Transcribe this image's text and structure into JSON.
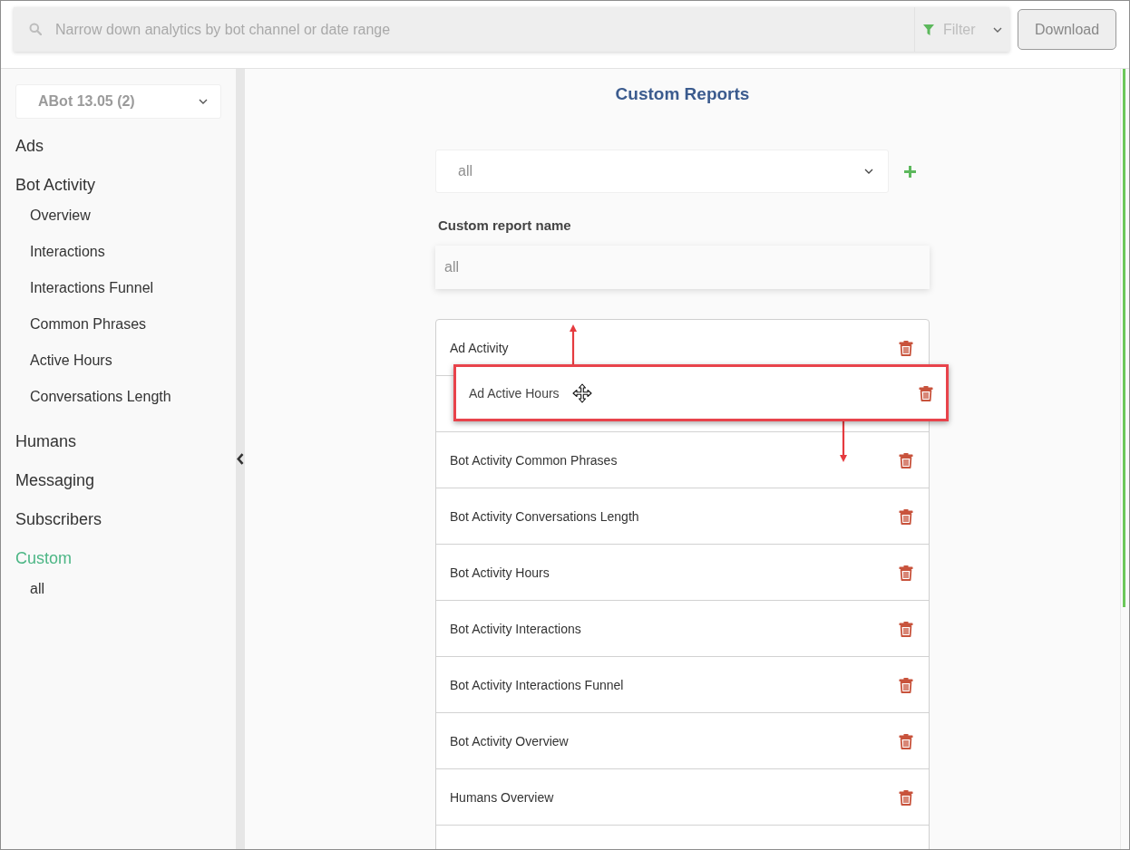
{
  "top_bar": {
    "search": {
      "placeholder": "Narrow down analytics by bot channel or date range"
    },
    "filter": {
      "label": "Filter"
    },
    "download_button": "Download"
  },
  "sidebar": {
    "bot_selector": {
      "value": "ABot 13.05 (2)"
    },
    "sections": [
      {
        "label": "Ads",
        "selected": false
      },
      {
        "label": "Bot Activity",
        "selected": false,
        "children": [
          {
            "label": "Overview",
            "selected": false
          },
          {
            "label": "Interactions",
            "selected": false
          },
          {
            "label": "Interactions Funnel",
            "selected": false
          },
          {
            "label": "Common Phrases",
            "selected": false
          },
          {
            "label": "Active Hours",
            "selected": false
          },
          {
            "label": "Conversations Length",
            "selected": false
          }
        ]
      },
      {
        "label": "Humans",
        "selected": false
      },
      {
        "label": "Messaging",
        "selected": false
      },
      {
        "label": "Subscribers",
        "selected": false
      },
      {
        "label": "Custom",
        "selected": true,
        "children": [
          {
            "label": "all",
            "selected": false
          }
        ]
      }
    ]
  },
  "main": {
    "title": "Custom Reports",
    "report_select": {
      "value": "all"
    },
    "name_field": {
      "label": "Custom report name",
      "value": "all"
    },
    "reports": [
      {
        "kind": "item",
        "label": "Ad Activity"
      },
      {
        "kind": "placeholder"
      },
      {
        "kind": "item",
        "label": "Bot Activity Common Phrases"
      },
      {
        "kind": "item",
        "label": "Bot Activity Conversations Length"
      },
      {
        "kind": "item",
        "label": "Bot Activity Hours"
      },
      {
        "kind": "item",
        "label": "Bot Activity Interactions"
      },
      {
        "kind": "item",
        "label": "Bot Activity Interactions Funnel"
      },
      {
        "kind": "item",
        "label": "Bot Activity Overview"
      },
      {
        "kind": "item",
        "label": "Humans Overview"
      },
      {
        "kind": "cut"
      }
    ],
    "dragged_item": {
      "label": "Ad Active Hours",
      "highlighted": true
    }
  }
}
